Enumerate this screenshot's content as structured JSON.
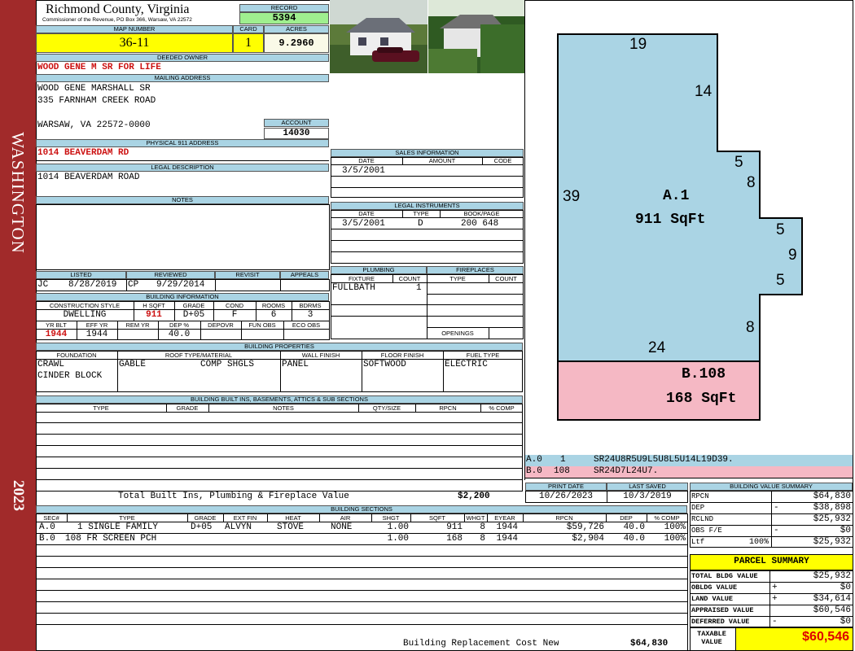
{
  "sidebar": {
    "district": "WASHINGTON",
    "year": "2023"
  },
  "county": {
    "name": "Richmond County, Virginia",
    "address": "Commissioner of the Revenue, PO Box 366, Warsaw, VA 22572"
  },
  "record": {
    "label": "RECORD",
    "value": "5394"
  },
  "map": {
    "label": "MAP NUMBER",
    "value": "36-11"
  },
  "card": {
    "label": "CARD",
    "value": "1"
  },
  "acres": {
    "label": "ACRES",
    "value": "9.2960"
  },
  "owner": {
    "label": "DEEDED OWNER",
    "value": "WOOD GENE M SR FOR LIFE"
  },
  "mailing": {
    "label": "MAILING ADDRESS",
    "line1": "WOOD GENE MARSHALL SR",
    "line2": "335 FARNHAM CREEK ROAD",
    "line3": "WARSAW, VA 22572-0000"
  },
  "account": {
    "label": "ACCOUNT",
    "value": "14030"
  },
  "physical": {
    "label": "PHYSICAL 911 ADDRESS",
    "value": "1014 BEAVERDAM RD"
  },
  "legal": {
    "label": "LEGAL DESCRIPTION",
    "value": "1014 BEAVERDAM ROAD"
  },
  "notes": {
    "label": "NOTES"
  },
  "sales": {
    "label": "SALES INFORMATION",
    "col_date": "DATE",
    "col_amount": "AMOUNT",
    "col_code": "CODE",
    "row1_date": "3/5/2001"
  },
  "instruments": {
    "label": "LEGAL INSTRUMENTS",
    "col_date": "DATE",
    "col_type": "TYPE",
    "col_book": "BOOK/PAGE",
    "row1_date": "3/5/2001",
    "row1_type": "D",
    "row1_book": "200 648"
  },
  "listed": {
    "listed_label": "LISTED",
    "reviewed_label": "REVIEWED",
    "revisit_label": "REVISIT",
    "appeals_label": "APPEALS",
    "listed_by": "JC",
    "listed_date": "8/28/2019",
    "reviewed_by": "CP",
    "reviewed_date": "9/29/2014"
  },
  "building_info": {
    "label": "BUILDING INFORMATION",
    "h_style": "CONSTRUCTION STYLE",
    "h_sqft": "H SQFT",
    "h_grade": "GRADE",
    "h_cond": "COND",
    "h_rooms": "ROOMS",
    "h_bdrms": "BDRMS",
    "style": "DWELLING",
    "sqft": "911",
    "grade": "D+05",
    "cond": "F",
    "rooms": "6",
    "bdrms": "3",
    "h_yrblt": "YR BLT",
    "h_effyr": "EFF YR",
    "h_remyr": "REM YR",
    "h_dep": "DEP %",
    "h_depovr": "DEPOVR",
    "h_funobs": "FUN OBS",
    "h_ecoobs": "ECO OBS",
    "yrblt": "1944",
    "effyr": "1944",
    "dep": "40.0"
  },
  "plumbing": {
    "label": "PLUMBING",
    "col_fixture": "FIXTURE",
    "col_count": "COUNT",
    "row1_fixture": "FULLBATH",
    "row1_count": "1"
  },
  "fireplaces": {
    "label": "FIREPLACES",
    "col_type": "TYPE",
    "col_count": "COUNT",
    "openings_label": "OPENINGS"
  },
  "properties": {
    "label": "BUILDING PROPERTIES",
    "h_foundation": "FOUNDATION",
    "h_roof": "ROOF TYPE/MATERIAL",
    "h_wall": "WALL FINISH",
    "h_floor": "FLOOR FINISH",
    "h_fuel": "FUEL TYPE",
    "foundation1": "CRAWL",
    "foundation2": "CINDER BLOCK",
    "roof_type": "GABLE",
    "roof_material": "COMP SHGLS",
    "wall": "PANEL",
    "floor": "SOFTWOOD",
    "fuel": "ELECTRIC"
  },
  "builtins": {
    "label": "BUILDING BUILT INS, BASEMENTS, ATTICS & SUB SECTIONS",
    "h_type": "TYPE",
    "h_grade": "GRADE",
    "h_notes": "NOTES",
    "h_qty": "QTY/SIZE",
    "h_rpcn": "RPCN",
    "h_comp": "% COMP",
    "total_label": "Total Built Ins, Plumbing & Fireplace Value",
    "total_value": "$2,200"
  },
  "sketch": {
    "sec_a_label": "A.1",
    "sec_a_area": "911 SqFt",
    "sec_b_label": "B.108",
    "sec_b_area": "168 SqFt",
    "dim_top": "19",
    "dim_14": "14",
    "dim_5a": "5",
    "dim_8a": "8",
    "dim_left": "39",
    "dim_5b": "5",
    "dim_9": "9",
    "dim_5c": "5",
    "dim_8b": "8",
    "dim_24": "24",
    "vector_a_code": "A.0",
    "vector_a_num": "1",
    "vector_a_path": "SR24U8R5U9L5U8L5U14L19D39.",
    "vector_b_code": "B.0",
    "vector_b_num": "108",
    "vector_b_path": "SR24D7L24U7."
  },
  "dates": {
    "print_label": "PRINT DATE",
    "saved_label": "LAST SAVED",
    "print_date": "10/26/2023",
    "last_saved": "10/3/2019"
  },
  "sections": {
    "label": "BUILDING SECTIONS",
    "h_sec": "SEC#",
    "h_type": "TYPE",
    "h_grade": "GRADE",
    "h_extfin": "EXT FIN",
    "h_heat": "HEAT",
    "h_air": "AIR",
    "h_shgt": "SHGT",
    "h_sqft": "SQFT",
    "h_whgt": "WHGT",
    "h_eyear": "EYEAR",
    "h_rpcn": "RPCN",
    "h_dep": "DEP",
    "h_comp": "% COMP",
    "rows": [
      {
        "sec": "A.0",
        "type": "1 SINGLE FAMILY",
        "grade": "D+05",
        "extfin": "ALVYN",
        "heat": "STOVE",
        "air": "NONE",
        "shgt": "1.00",
        "sqft": "911",
        "whgt": "8",
        "eyear": "1944",
        "rpcn": "$59,726",
        "dep": "40.0",
        "comp": "100%"
      },
      {
        "sec": "B.0",
        "type": "108 FR SCREEN PCH",
        "grade": "",
        "extfin": "",
        "heat": "",
        "air": "",
        "shgt": "1.00",
        "sqft": "168",
        "whgt": "8",
        "eyear": "1944",
        "rpcn": "$2,904",
        "dep": "40.0",
        "comp": "100%"
      }
    ],
    "replacement_label": "Building Replacement Cost New",
    "replacement_value": "$64,830"
  },
  "value_summary": {
    "label": "BUILDING VALUE SUMMARY",
    "rpcn_label": "RPCN",
    "rpcn_value": "$64,830",
    "dep_label": "DEP",
    "dep_sign": "-",
    "dep_value": "$38,898",
    "rclnd_label": "RCLND",
    "rclnd_value": "$25,932",
    "obs_label": "OBS F/E",
    "obs_sign": "-",
    "obs_value": "$0",
    "ltf_label": "Ltf",
    "ltf_pct": "100%",
    "ltf_value": "$25,932"
  },
  "parcel": {
    "label": "PARCEL SUMMARY",
    "bldg_label": "TOTAL BLDG VALUE",
    "bldg_value": "$25,932",
    "obldg_label": "OBLDG VALUE",
    "obldg_sign": "+",
    "obldg_value": "$0",
    "land_label": "LAND VALUE",
    "land_sign": "+",
    "land_value": "$34,614",
    "appraised_label": "APPRAISED VALUE",
    "appraised_value": "$60,546",
    "deferred_label": "DEFERRED VALUE",
    "deferred_sign": "-",
    "deferred_value": "$0",
    "taxable_label1": "TAXABLE",
    "taxable_label2": "VALUE",
    "taxable_value": "$60,546"
  },
  "colors": {
    "sidebar": "#a12a2a",
    "header_blue": "#aad4e4",
    "yellow": "#ffff00",
    "green": "#9fef8f",
    "section_a": "#aad4e4",
    "section_b": "#f5b8c4"
  }
}
